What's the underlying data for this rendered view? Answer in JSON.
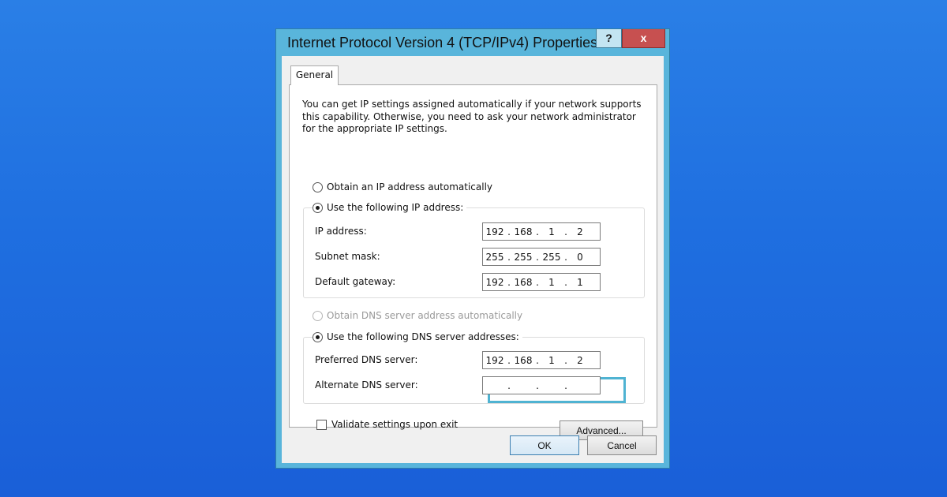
{
  "window": {
    "title": "Internet Protocol Version 4 (TCP/IPv4) Properties",
    "help_label": "?",
    "close_label": "x"
  },
  "tab": {
    "label": "General"
  },
  "description": "You can get IP settings assigned automatically if your network supports this capability. Otherwise, you need to ask your network administrator for the appropriate IP settings.",
  "ip_section": {
    "auto_label": "Obtain an IP address automatically",
    "manual_label": "Use the following IP address:",
    "fields": [
      {
        "label": "IP address:",
        "octets": [
          "192",
          "168",
          "1",
          "2"
        ]
      },
      {
        "label": "Subnet mask:",
        "octets": [
          "255",
          "255",
          "255",
          "0"
        ]
      },
      {
        "label": "Default gateway:",
        "octets": [
          "192",
          "168",
          "1",
          "1"
        ]
      }
    ]
  },
  "dns_section": {
    "auto_label": "Obtain DNS server address automatically",
    "manual_label": "Use the following DNS server addresses:",
    "fields": [
      {
        "label": "Preferred DNS server:",
        "octets": [
          "192",
          "168",
          "1",
          "2"
        ]
      },
      {
        "label": "Alternate DNS server:",
        "octets": [
          "",
          "",
          "",
          ""
        ]
      }
    ]
  },
  "validate_label": "Validate settings upon exit",
  "advanced_label": "Advanced...",
  "ok_label": "OK",
  "cancel_label": "Cancel",
  "colors": {
    "background": "#1f6fe0",
    "window_frame": "#59b5db",
    "close_button": "#c75050",
    "highlight": "#4fb3d2"
  }
}
